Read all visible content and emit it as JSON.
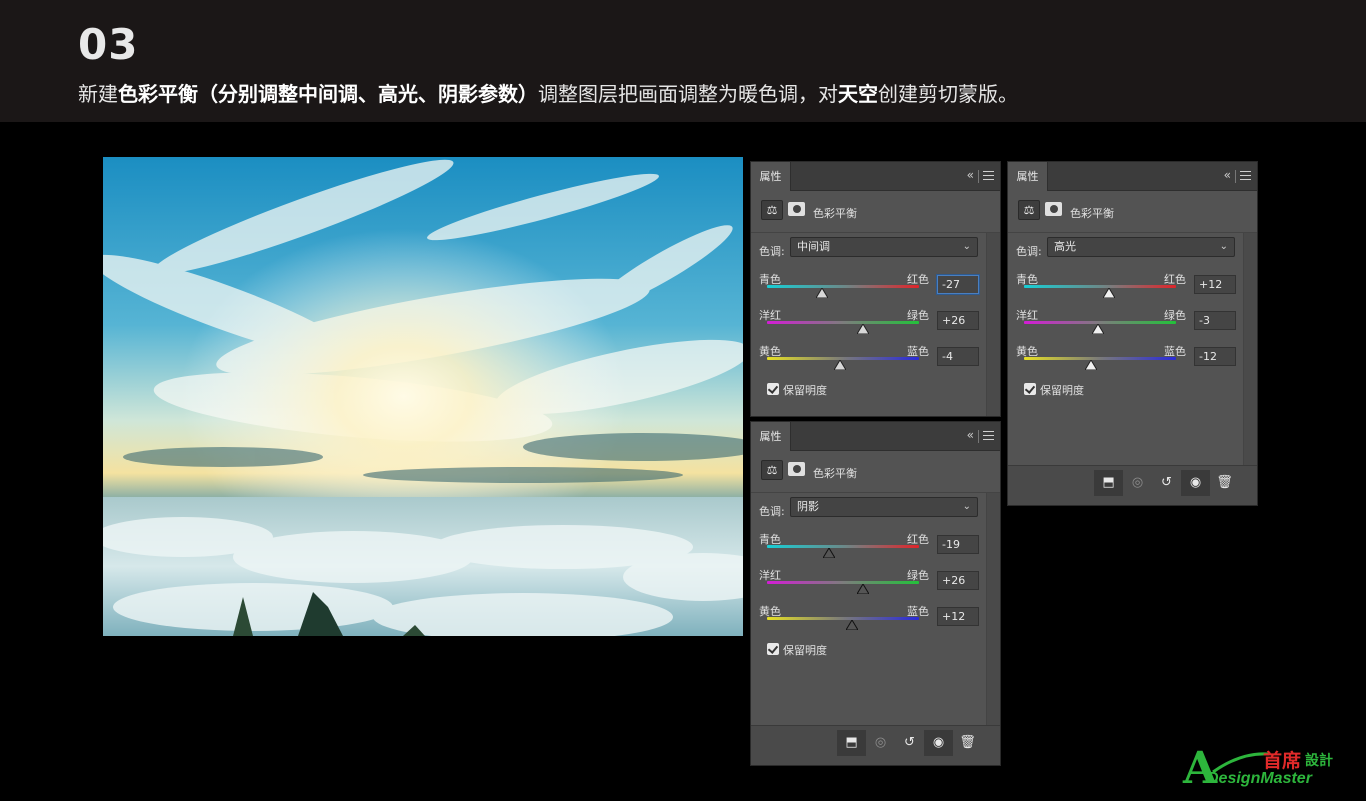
{
  "header": {
    "step": "03",
    "instruction": {
      "p1": "新建",
      "b1": "色彩平衡（分别调整中间调、高光、阴影参数）",
      "p2": "调整图层把画面调整为暖色调，对",
      "b2": "天空",
      "p3": "创建剪切蒙版。"
    }
  },
  "panels": {
    "midtones": {
      "tab": "属性",
      "collapse": "«",
      "title": "色彩平衡",
      "tone_label": "色调:",
      "tone_value": "中间调",
      "sliders": [
        {
          "left": "青色",
          "right": "红色",
          "value": "-27",
          "level": -27
        },
        {
          "left": "洋红",
          "right": "绿色",
          "value": "+26",
          "level": 26
        },
        {
          "left": "黄色",
          "right": "蓝色",
          "value": "-4",
          "level": -4
        }
      ],
      "preserve": "保留明度"
    },
    "highlights": {
      "tab": "属性",
      "collapse": "«",
      "title": "色彩平衡",
      "tone_label": "色调:",
      "tone_value": "高光",
      "sliders": [
        {
          "left": "青色",
          "right": "红色",
          "value": "+12",
          "level": 12
        },
        {
          "left": "洋红",
          "right": "绿色",
          "value": "-3",
          "level": -3
        },
        {
          "left": "黄色",
          "right": "蓝色",
          "value": "-12",
          "level": -12
        }
      ],
      "preserve": "保留明度"
    },
    "shadows": {
      "tab": "属性",
      "collapse": "«",
      "title": "色彩平衡",
      "tone_label": "色调:",
      "tone_value": "阴影",
      "sliders": [
        {
          "left": "青色",
          "right": "红色",
          "value": "-19",
          "level": -19
        },
        {
          "left": "洋红",
          "right": "绿色",
          "value": "+26",
          "level": 26
        },
        {
          "left": "黄色",
          "right": "蓝色",
          "value": "+12",
          "level": 12
        }
      ],
      "preserve": "保留明度"
    }
  },
  "footer_icons": [
    "clip-to-layer-icon",
    "view-previous-icon",
    "reset-icon",
    "visibility-eye-icon",
    "trash-icon"
  ],
  "logo": {
    "cn": "首席",
    "cn_small": "設計",
    "en": "DesignMaster"
  },
  "colors": {
    "header_bg": "#1b1717",
    "panel_bg": "#535353",
    "logo_green": "#2db53c",
    "logo_red": "#e12a2a"
  }
}
